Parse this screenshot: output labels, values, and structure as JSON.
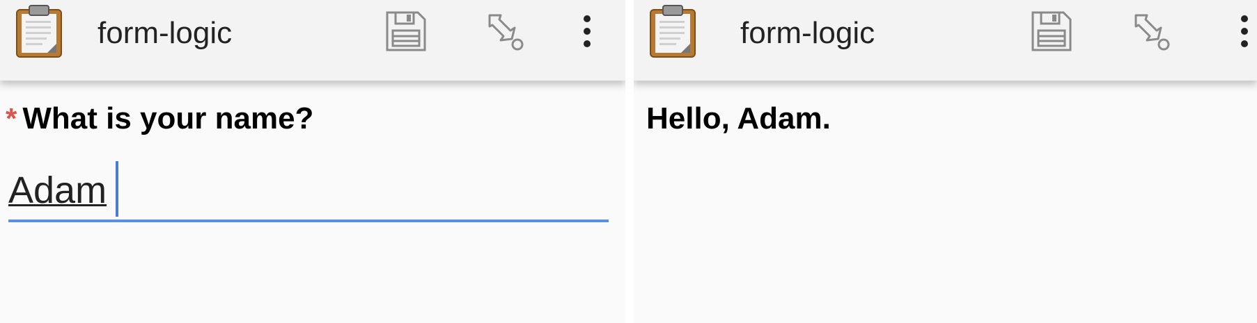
{
  "left": {
    "app_title": "form-logic",
    "icons": {
      "app": "clipboard-icon",
      "save": "save-icon",
      "jump": "jump-icon",
      "more": "more-vert-icon"
    },
    "question": {
      "required_mark": "*",
      "label": "What is your name?"
    },
    "answer": {
      "value": "Adam"
    }
  },
  "right": {
    "app_title": "form-logic",
    "icons": {
      "app": "clipboard-icon",
      "save": "save-icon",
      "jump": "jump-icon",
      "more": "more-vert-icon"
    },
    "greeting": "Hello, Adam."
  },
  "colors": {
    "accent": "#5b8fdf",
    "required": "#d9534f",
    "appbar": "#f3f3f3"
  }
}
